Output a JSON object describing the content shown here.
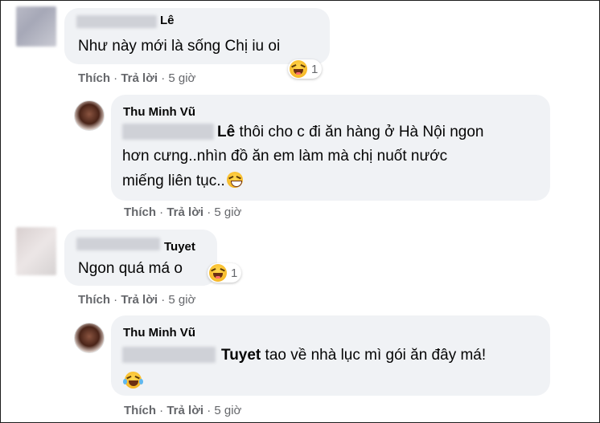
{
  "comments": [
    {
      "name": "Lê",
      "text": "Như này mới là sống Chị iu oi",
      "reaction_count": "1",
      "actions": {
        "like": "Thích",
        "reply": "Trả lời",
        "sep": "·",
        "time": "5 giờ"
      }
    },
    {
      "name": "Thu Minh Vũ",
      "tag": "Lê",
      "text_line1": "thôi cho c đi ăn hàng ở Hà Nội ngon",
      "text_line2": "hơn cưng..nhìn đồ ăn em làm mà chị nuốt nước",
      "text_line3": "miếng liên tục..",
      "actions": {
        "like": "Thích",
        "reply": "Trả lời",
        "sep": "·",
        "time": "5 giờ"
      }
    },
    {
      "name": "Tuyet",
      "text": "Ngon quá má o",
      "reaction_count": "1",
      "actions": {
        "like": "Thích",
        "reply": "Trả lời",
        "sep": "·",
        "time": "5 giờ"
      }
    },
    {
      "name": "Thu Minh Vũ",
      "tag": "Tuyet",
      "text_line1": "tao về nhà lục mì gói ăn đây má!",
      "actions": {
        "like": "Thích",
        "reply": "Trả lời",
        "sep": "·",
        "time": "5 giờ"
      }
    }
  ],
  "colors": {
    "bubble": "#f0f2f5",
    "action_text": "#65676b",
    "reaction": "#f7b928"
  },
  "icons": [
    "laughing-emoji-icon",
    "grinning-emoji-icon",
    "tears-of-joy-emoji-icon"
  ]
}
